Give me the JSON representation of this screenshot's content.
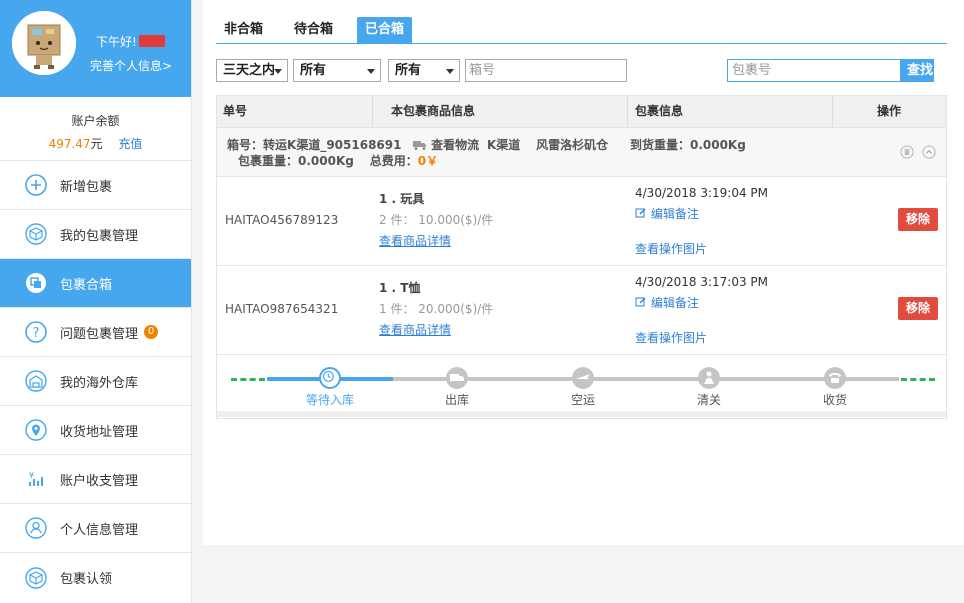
{
  "sidebar": {
    "greeting": "下午好!",
    "profile_link": "完善个人信息>",
    "balance_label": "账户余额",
    "balance_amount": "497.47",
    "balance_unit": "元",
    "recharge": "充值",
    "items": [
      {
        "label": "新增包裹",
        "icon": "plus-circle-icon"
      },
      {
        "label": "我的包裹管理",
        "icon": "package-icon"
      },
      {
        "label": "包裹合箱",
        "icon": "merge-box-icon",
        "active": true
      },
      {
        "label": "问题包裹管理",
        "icon": "question-icon",
        "badge": "0"
      },
      {
        "label": "我的海外仓库",
        "icon": "warehouse-icon"
      },
      {
        "label": "收货地址管理",
        "icon": "location-pin-icon"
      },
      {
        "label": "账户收支管理",
        "icon": "finance-icon"
      },
      {
        "label": "个人信息管理",
        "icon": "user-icon"
      },
      {
        "label": "包裹认领",
        "icon": "package-claim-icon"
      }
    ]
  },
  "tabs": [
    "非合箱",
    "待合箱",
    "已合箱"
  ],
  "active_tab": "已合箱",
  "filters": {
    "date_range": "三天之内",
    "status1": "所有",
    "status2": "所有",
    "box_no_placeholder": "箱号",
    "parcel_no_placeholder": "包裹号",
    "search_label": "查找"
  },
  "table": {
    "headers": [
      "单号",
      "本包裹商品信息",
      "包裹信息",
      "操作"
    ],
    "box": {
      "box_label": "箱号：",
      "box_id": "转运K渠道_905168691",
      "track_label": "查看物流",
      "channel": "K渠道",
      "warehouse": "风雷洛杉矶仓",
      "arrival_weight_label": "到货重量：",
      "arrival_weight": "0.000Kg",
      "parcel_weight_label": "包裹重量：",
      "parcel_weight": "0.000Kg",
      "total_fee_label": "总费用：",
      "total_fee": "0￥"
    },
    "rows": [
      {
        "order_no": "HAITAO456789123",
        "product": "1 . 玩具",
        "qty": "2 件： 10.000($)/件",
        "detail_link": "查看商品详情",
        "time": "4/30/2018 3:19:04 PM",
        "edit_note": "编辑备注",
        "view_photos": "查看操作图片",
        "action": "移除"
      },
      {
        "order_no": "HAITAO987654321",
        "product": "1 . T恤",
        "qty": "1 件： 20.000($)/件",
        "detail_link": "查看商品详情",
        "time": "4/30/2018 3:17:03 PM",
        "edit_note": "编辑备注",
        "view_photos": "查看操作图片",
        "action": "移除"
      }
    ],
    "stages": [
      {
        "label": "等待入库",
        "icon": "clock-icon",
        "done": true
      },
      {
        "label": "出库",
        "icon": "truck-icon",
        "done": false
      },
      {
        "label": "空运",
        "icon": "plane-icon",
        "done": false
      },
      {
        "label": "清关",
        "icon": "customs-icon",
        "done": false
      },
      {
        "label": "收货",
        "icon": "phone-icon",
        "done": false
      }
    ]
  },
  "colors": {
    "primary": "#47a7ee",
    "accent": "#f08200",
    "danger": "#e04c3e",
    "progress_dash": "#2db45a"
  }
}
